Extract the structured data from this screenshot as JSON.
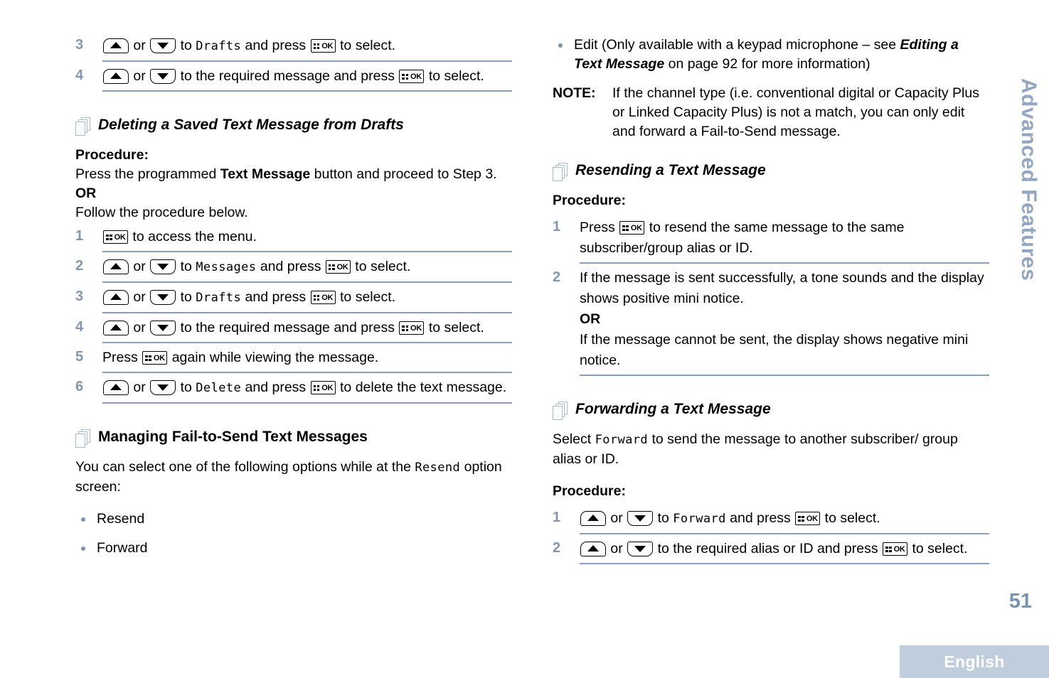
{
  "document": {
    "page_number": "51",
    "side_tab": "Advanced Features",
    "language_band": "English"
  },
  "icons": {
    "ok_key": "ok-key-icon",
    "up_key": "up-arrow-key-icon",
    "down_key": "down-arrow-key-icon",
    "section_marker": "stacked-pages-icon",
    "bullet": "bullet-dot-icon"
  },
  "left_column": {
    "continued_steps": [
      {
        "num": "3",
        "pre": "",
        "or_word": "or",
        "mid": "to",
        "mono": "Drafts",
        "post_a": "and press",
        "post_b": "to select."
      },
      {
        "num": "4",
        "pre": "",
        "or_word": "or",
        "mid": "to the required message and press",
        "mono": "",
        "post_a": "",
        "post_b": "to select."
      }
    ],
    "section_delete": {
      "heading": "Deleting a Saved Text Message from Drafts",
      "procedure_label": "Procedure:",
      "intro_lead": "Press the programmed",
      "intro_bold": "Text Message",
      "intro_tail": "button and proceed to Step 3.",
      "or_label": "OR",
      "follow_text": "Follow the procedure below.",
      "steps": [
        {
          "num": "1",
          "text_after_key": "to access the menu."
        },
        {
          "num": "2",
          "or_word": "or",
          "mid": "to",
          "mono": "Messages",
          "post_a": "and press",
          "post_b": "to select."
        },
        {
          "num": "3",
          "or_word": "or",
          "mid": "to",
          "mono": "Drafts",
          "post_a": "and press",
          "post_b": "to select."
        },
        {
          "num": "4",
          "or_word": "or",
          "mid": "to the required message and press",
          "mono": "",
          "post_a": "",
          "post_b": "to select."
        },
        {
          "num": "5",
          "lead": "Press",
          "tail": "again while viewing the message."
        },
        {
          "num": "6",
          "or_word": "or",
          "mid": "to",
          "mono": "Delete",
          "post_a": "and press",
          "post_b": "to delete the text message."
        }
      ]
    },
    "section_managing": {
      "heading": "Managing Fail-to-Send Text Messages",
      "intro_lead": "You can select one of the following options while at the",
      "intro_mono": "Resend",
      "intro_tail": "option screen:",
      "bullets": [
        "Resend",
        "Forward"
      ]
    }
  },
  "right_column": {
    "edit_bullet": {
      "lead": "Edit (Only available with a keypad microphone – see",
      "italic": "Editing a Text Message",
      "tail": "on page 92 for more information)"
    },
    "note": {
      "label": "NOTE:",
      "text": "If the channel type (i.e. conventional digital or Capacity Plus or Linked Capacity Plus) is not a match, you can only edit and forward a Fail-to-Send message."
    },
    "section_resending": {
      "heading": "Resending a Text Message",
      "procedure_label": "Procedure:",
      "steps": [
        {
          "num": "1",
          "lead": "Press",
          "tail": "to resend the same message to the same subscriber/group alias or ID."
        },
        {
          "num": "2",
          "line1": "If the message is sent successfully, a tone sounds and the display shows positive mini notice.",
          "or_label": "OR",
          "line2": "If the message cannot be sent, the display shows negative mini notice."
        }
      ]
    },
    "section_forwarding": {
      "heading": "Forwarding a Text Message",
      "intro_lead": "Select",
      "intro_mono": "Forward",
      "intro_tail": "to send the message to another subscriber/ group alias or ID.",
      "procedure_label": "Procedure:",
      "steps": [
        {
          "num": "1",
          "or_word": "or",
          "mid": "to",
          "mono": "Forward",
          "post_a": "and press",
          "post_b": "to select."
        },
        {
          "num": "2",
          "or_word": "or",
          "mid": "to the required alias or ID and press",
          "mono": "",
          "post_a": "",
          "post_b": "to select."
        }
      ]
    }
  }
}
